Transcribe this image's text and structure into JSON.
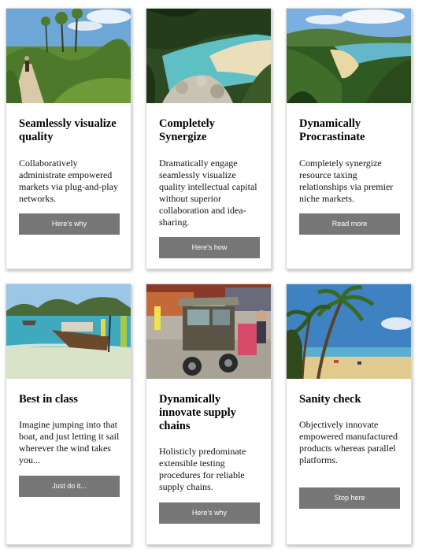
{
  "cards": [
    {
      "title": "Seamlessly visualize quality",
      "text": "Collaboratively administrate empowered markets via plug-and-play networks.",
      "button": "Here's why"
    },
    {
      "title": "Completely Synergize",
      "text": "Dramatically engage seamlessly visualize quality intellectual capital without superior collaboration and idea-sharing.",
      "button": "Here's how"
    },
    {
      "title": "Dynamically Procrastinate",
      "text": "Completely synergize resource taxing relationships via premier niche markets.",
      "button": "Read more"
    },
    {
      "title": "Best in class",
      "text": "Imagine jumping into that boat, and just letting it sail wherever the wind takes you...",
      "button": "Just do it..."
    },
    {
      "title": "Dynamically innovate supply chains",
      "text": "Holisticly predominate extensible testing procedures for reliable supply chains.",
      "button": "Here's why"
    },
    {
      "title": "Sanity check",
      "text": "Objectively innovate empowered manufactured products whereas parallel platforms.",
      "button": "Stop here"
    }
  ],
  "colors": {
    "button_bg": "#777777",
    "button_text": "#ffffff",
    "card_bg": "#ffffff"
  }
}
